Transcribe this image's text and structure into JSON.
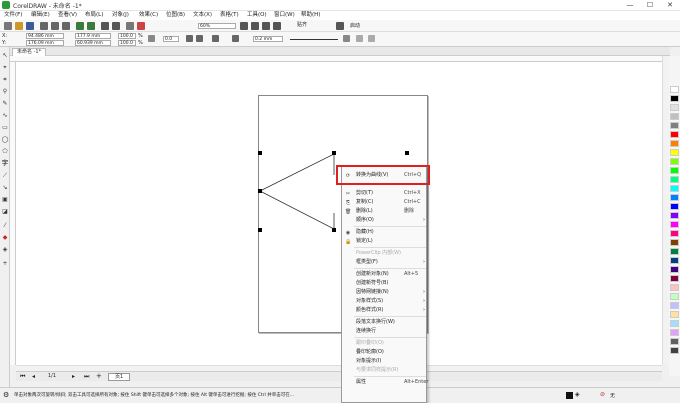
{
  "window": {
    "title": "CorelDRAW - 未命名 -1*",
    "min": "—",
    "max": "☐",
    "close": "✕"
  },
  "menu": [
    "文件(F)",
    "编辑(E)",
    "查看(V)",
    "布局(L)",
    "对象(J)",
    "效果(C)",
    "位图(B)",
    "文本(X)",
    "表格(T)",
    "工具(O)",
    "窗口(W)",
    "帮助(H)"
  ],
  "toolbar": {
    "zoom": "60%",
    "snap_label": "贴齐",
    "launch_label": "启动"
  },
  "propbar": {
    "x": "94.486 mm",
    "y": "176.09 mm",
    "w": "177.9 mm",
    "h": "60.939 mm",
    "sx": "100.0",
    "sy": "100.0",
    "unit": "%",
    "angle": "0.0",
    "outline": "0.2 mm"
  },
  "doc_tab": "未命名 -1*",
  "page_tab": "页1",
  "page_counter": "1/1",
  "context_menu": [
    {
      "icon": "curve-icon",
      "label": "转换为曲线(V)",
      "shortcut": "Ctrl+Q",
      "disabled": false
    },
    {
      "icon": "",
      "label": "",
      "shortcut": "",
      "disabled": true,
      "sep": true
    },
    {
      "icon": "cut-icon",
      "label": "剪切(T)",
      "shortcut": "Ctrl+X",
      "disabled": false
    },
    {
      "icon": "copy-icon",
      "label": "复制(C)",
      "shortcut": "Ctrl+C",
      "disabled": false
    },
    {
      "icon": "delete-icon",
      "label": "删除(L)",
      "shortcut": "删除",
      "disabled": false
    },
    {
      "icon": "",
      "label": "顺序(O)",
      "shortcut": "",
      "disabled": false,
      "arrow": true
    },
    {
      "icon": "hide-icon",
      "label": "隐藏(H)",
      "shortcut": "",
      "disabled": false
    },
    {
      "icon": "lock-icon",
      "label": "锁定(L)",
      "shortcut": "",
      "disabled": false
    },
    {
      "icon": "",
      "label": "PowerClip 内部(W)",
      "shortcut": "",
      "disabled": true
    },
    {
      "icon": "",
      "label": "框类型(F)",
      "shortcut": "",
      "disabled": false,
      "arrow": true
    },
    {
      "icon": "",
      "label": "创建新对象(N)",
      "shortcut": "Alt+5",
      "disabled": false
    },
    {
      "icon": "",
      "label": "创建新符号(B)",
      "shortcut": "",
      "disabled": false
    },
    {
      "icon": "",
      "label": "因特网链接(N)",
      "shortcut": "",
      "disabled": false,
      "arrow": true
    },
    {
      "icon": "",
      "label": "对象样式(S)",
      "shortcut": "",
      "disabled": false,
      "arrow": true
    },
    {
      "icon": "",
      "label": "颜色样式(R)",
      "shortcut": "",
      "disabled": false,
      "arrow": true
    },
    {
      "icon": "",
      "label": "段落文本换行(W)",
      "shortcut": "",
      "disabled": false
    },
    {
      "icon": "",
      "label": "连续换行",
      "shortcut": "",
      "disabled": false
    },
    {
      "icon": "",
      "label": "跟印叠印(O)",
      "shortcut": "",
      "disabled": true
    },
    {
      "icon": "",
      "label": "叠印轮廓(O)",
      "shortcut": "",
      "disabled": false
    },
    {
      "icon": "",
      "label": "对象提示(I)",
      "shortcut": "",
      "disabled": false
    },
    {
      "icon": "",
      "label": "与要求同样提示(R)",
      "shortcut": "",
      "disabled": true
    },
    {
      "icon": "",
      "label": "属性",
      "shortcut": "Alt+Enter",
      "disabled": false
    }
  ],
  "status": {
    "hint": "单击对象两次可旋转/倾斜; 双击工具可选择所有对象; 按住 Shift 键单击可选择多个对象; 按住 Alt 键单击可进行挖掘; 按住 Ctrl 并单击可在...",
    "fill_none": "无"
  },
  "colors": {
    "accent_red": "#e02020",
    "palette": [
      "#ffffff",
      "#000000",
      "#e0e0e0",
      "#c0c0c0",
      "#808080",
      "#ff0000",
      "#ff8000",
      "#ffff00",
      "#80ff00",
      "#00ff00",
      "#00ff80",
      "#00ffff",
      "#0080ff",
      "#0000ff",
      "#8000ff",
      "#ff00ff",
      "#ff0080",
      "#804000",
      "#008040",
      "#004080",
      "#400080",
      "#800040",
      "#ffc0c0",
      "#c0ffc0",
      "#c0c0ff",
      "#ffe0a0",
      "#a0e0ff",
      "#e0a0ff",
      "#606060",
      "#404040"
    ]
  }
}
